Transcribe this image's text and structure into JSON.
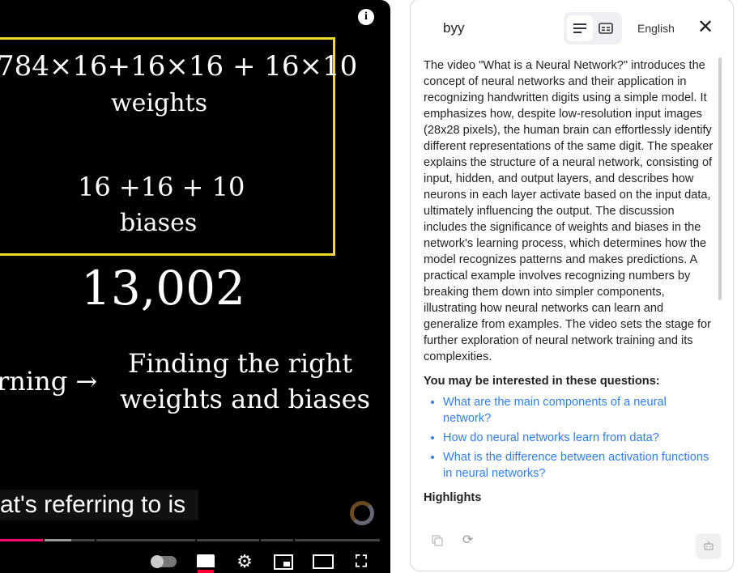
{
  "video": {
    "math": {
      "line1": "784×16+16×16 + 16×10",
      "weights": "weights",
      "line2": "16 +16 + 10",
      "biases": "biases",
      "total": "13,002",
      "learning": "rning →",
      "finding1": "Finding the right",
      "finding2": "weights and biases"
    },
    "caption": "at's referring to is",
    "info_icon": "info-icon",
    "progress_played_percent": 11,
    "accent": "#ff0033"
  },
  "panel": {
    "name": "byy",
    "language": "English",
    "summary": "The video \"What is a Neural Network?\" introduces the concept of neural networks and their application in recognizing handwritten digits using a simple model. It emphasizes how, despite low-resolution input images (28x28 pixels), the human brain can effortlessly identify different representations of the same digit. The speaker explains the structure of a neural network, consisting of input, hidden, and output layers, and describes how neurons in each layer activate based on the input data, ultimately influencing the output. The discussion includes the significance of weights and biases in the network's learning process, which determines how the model recognizes patterns and makes predictions. A practical example involves recognizing numbers by breaking them down into simpler components, illustrating how neural networks can learn and generalize from examples. The video sets the stage for further exploration of neural network training and its complexities.",
    "questions_heading": "You may be interested in these questions:",
    "questions": [
      "What are the main components of a neural network?",
      "How do neural networks learn from data?",
      "What is the difference between activation functions in neural networks?"
    ],
    "highlights_heading": "Highlights",
    "link_color": "#2f80ed"
  }
}
